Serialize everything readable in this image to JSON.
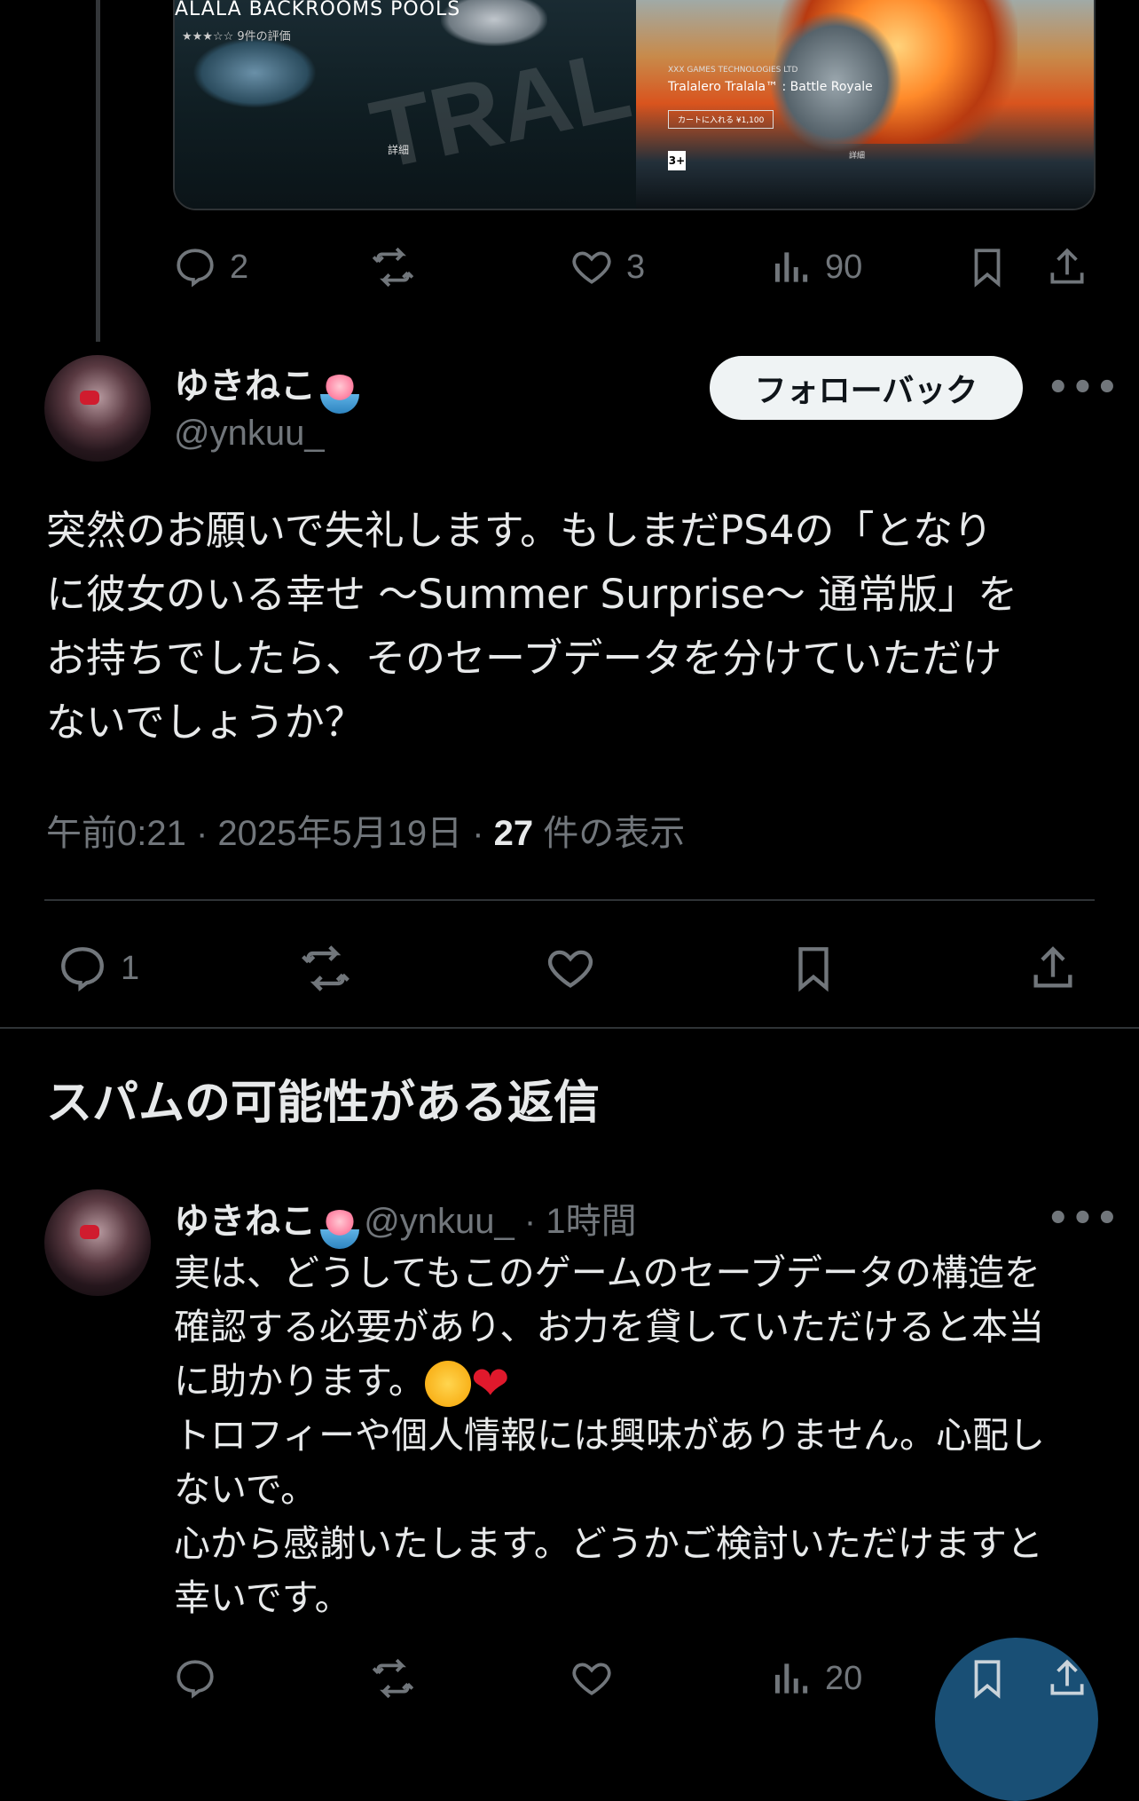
{
  "parent_tweet": {
    "media_left": {
      "title": "ALALA BACKROOMS POOLS",
      "rating": "★★★☆☆  9件の評価",
      "watermark": "TRALA",
      "detail": "詳細"
    },
    "media_right": {
      "subtitle": "XXX GAMES TECHNOLOGIES LTD",
      "title": "Tralalero Tralala™ : Battle Royale",
      "cart": "カートに入れる  ¥1,100",
      "age": "3+",
      "detail": "詳細"
    },
    "actions": {
      "replies": "2",
      "likes": "3",
      "views": "90"
    }
  },
  "main_tweet": {
    "author_name": "ゆきねこ",
    "author_handle": "@ynkuu_",
    "follow_label": "フォローバック",
    "more": "•••",
    "text_lines": [
      "突然のお願いで失礼します。もしまだPS4の「となり",
      "に彼女のいる幸せ 〜Summer Surprise〜 通常版」を",
      "お持ちでしたら、そのセーブデータを分けていただけ",
      "ないでしょうか？"
    ],
    "timestamp": "午前0:21 · 2025年5月19日 · ",
    "views_count": "27",
    "views_label": " 件の表示",
    "actions": {
      "replies": "1"
    }
  },
  "spam_section": {
    "title": "スパムの可能性がある返信"
  },
  "reply_tweet": {
    "author_name": "ゆきねこ",
    "author_handle": "@ynkuu_",
    "time": " · 1時間",
    "more": "•••",
    "lines": [
      "実は、どうしてもこのゲームのセーブデータの構造を",
      "確認する必要があり、お力を貸していただけると本当",
      "に助かります。",
      "トロフィーや個人情報には興味がありません。心配し",
      "ないで。",
      "心から感謝いたします。どうかご検討いただけますと",
      "幸いです。"
    ],
    "actions": {
      "views": "20"
    }
  },
  "colors": {
    "background": "#000000",
    "text": "#e7e9ea",
    "muted": "#71767b",
    "divider": "#2f3336",
    "follow_bg": "#eff3f4"
  }
}
